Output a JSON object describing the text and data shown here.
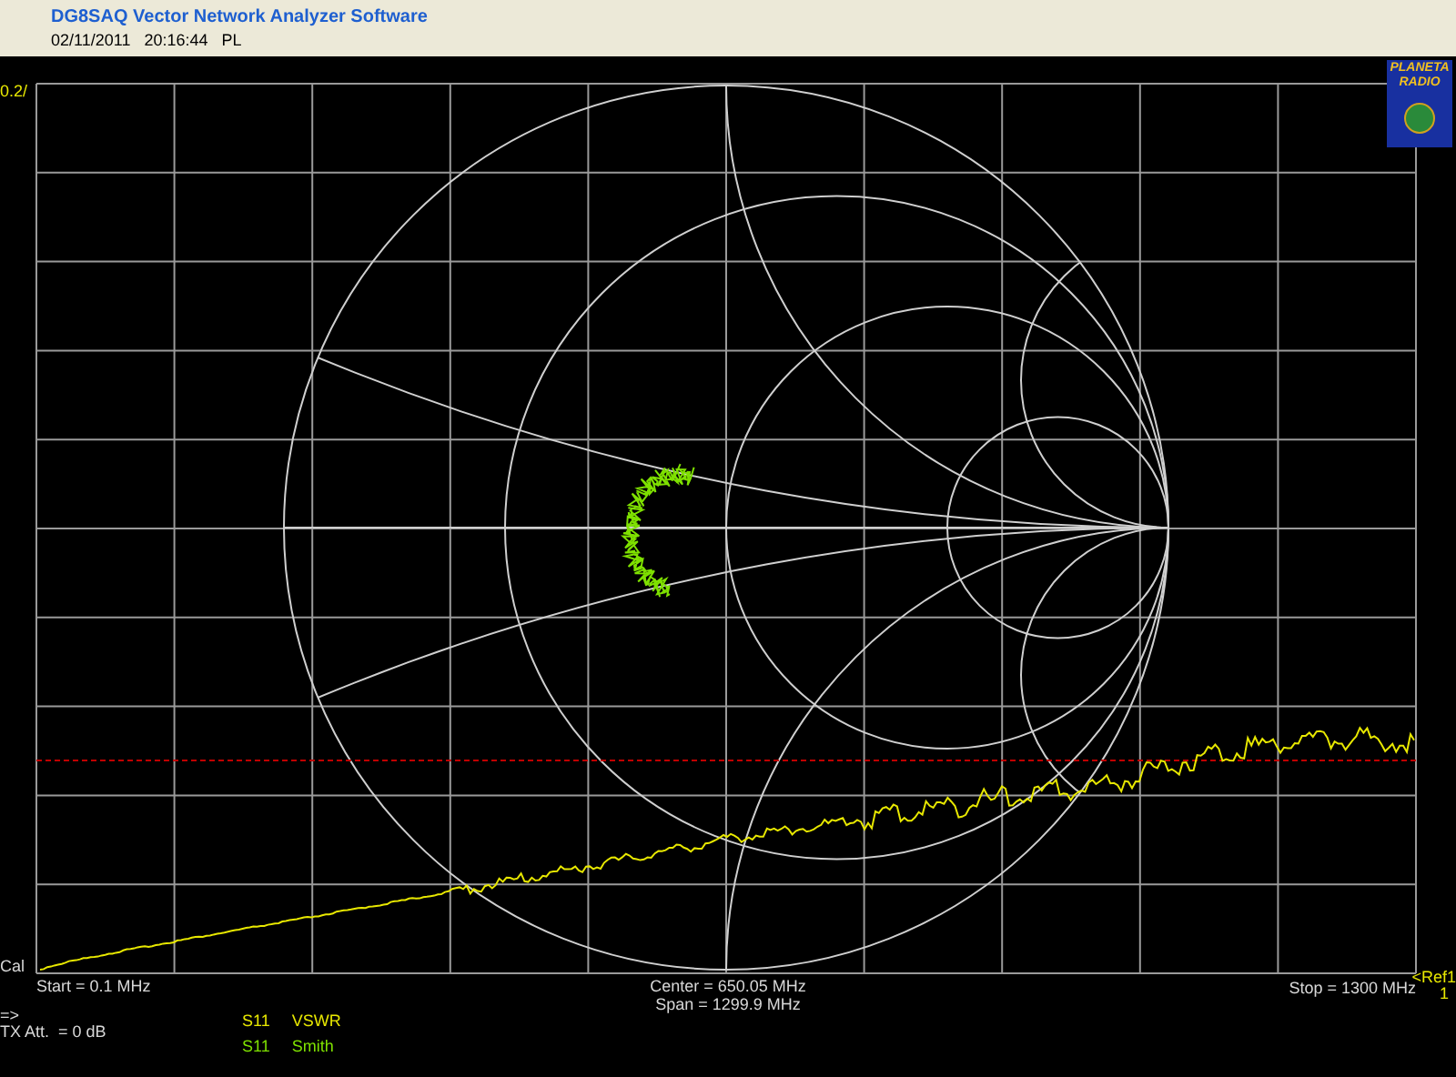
{
  "header": {
    "title": "DG8SAQ Vector Network Analyzer Software",
    "timestamp": "02/11/2011   20:16:44   PL"
  },
  "logo": {
    "lines": [
      "PLANETA",
      "RADIO"
    ]
  },
  "plot": {
    "scale_label": "0.2/",
    "cal_label": "Cal",
    "start": "Start = 0.1 MHz",
    "center": "Center = 650.05 MHz",
    "span": "Span = 1299.9 MHz",
    "stop": "Stop = 1300 MHz",
    "ref_marker": "<Ref1",
    "ref_index": "1"
  },
  "status": {
    "arrow": "=>",
    "tx_att": "TX Att.  = 0 dB"
  },
  "traces": [
    {
      "param": "S11",
      "name": "VSWR",
      "kind": "vswr",
      "color": "#e8e800"
    },
    {
      "param": "S11",
      "name": "Smith",
      "kind": "smith",
      "color": "#7ee000"
    }
  ]
}
